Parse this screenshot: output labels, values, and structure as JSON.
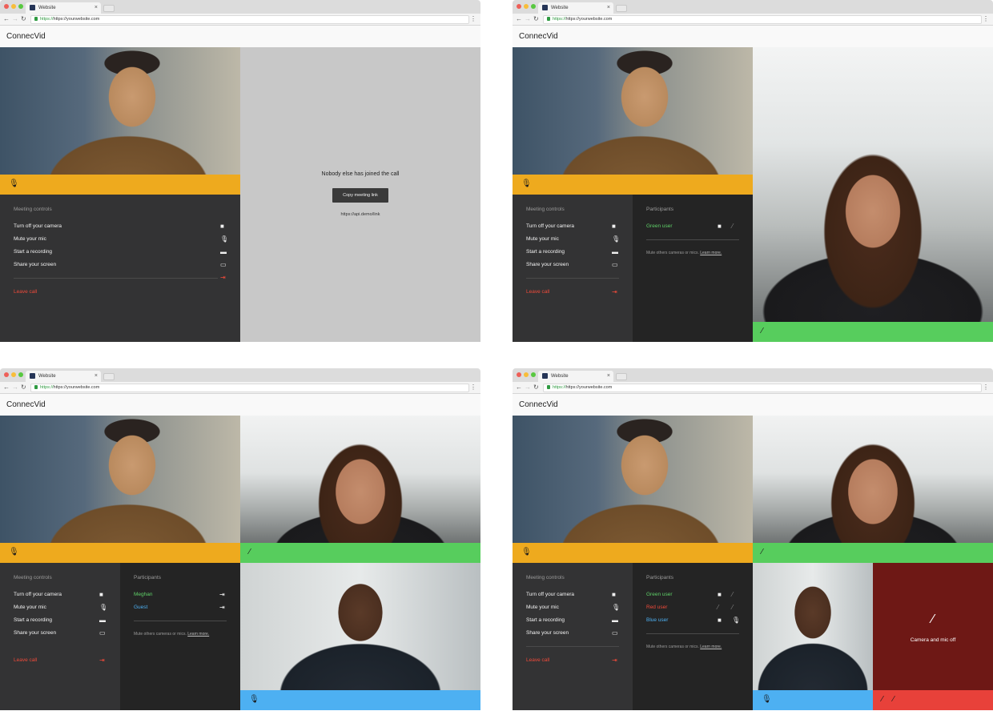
{
  "browser": {
    "tab_title": "Website",
    "tab_close": "×",
    "url_proto": "https://",
    "url_rest": "https://yourwebsite.com",
    "back": "←",
    "forward": "→",
    "reload": "↻",
    "menu": "⋮"
  },
  "app": {
    "brand": "ConnecVid"
  },
  "icons": {
    "mic": "🎙",
    "mic_off": "⁄",
    "camera": "■",
    "record": "▬",
    "screen": "▭",
    "leave": "⇥",
    "cam_off": "⁄"
  },
  "controls": {
    "title": "Meeting controls",
    "camera": "Turn off your camera",
    "mic": "Mute your mic",
    "record": "Start a recording",
    "screen": "Share your screen",
    "leave": "Leave call"
  },
  "participants_title": "Participants",
  "note": {
    "text": "Mute others cameras or mics.",
    "link": "Learn more."
  },
  "screen1": {
    "nobody": "Nobody else has joined the call",
    "copy_button": "Copy meeting link",
    "link": "https://api.demo/link"
  },
  "screen2": {
    "participants": [
      {
        "name": "Green user",
        "color": "#5fd068"
      }
    ]
  },
  "screen3": {
    "participants": [
      {
        "name": "Meghan",
        "color": "#5fd068"
      },
      {
        "name": "Guest",
        "color": "#4db0f2"
      }
    ]
  },
  "screen4": {
    "participants": [
      {
        "name": "Green user",
        "color": "#5fd068"
      },
      {
        "name": "Red user",
        "color": "#ef4a3a"
      },
      {
        "name": "Blue user",
        "color": "#4db0f2"
      }
    ],
    "camera_off": "Camera and mic off"
  },
  "colors": {
    "orange": "#eeaa1e",
    "green": "#57cd5d",
    "blue": "#4db0f2",
    "red": "#e8413a",
    "panel": "#333334",
    "panel_dark": "#242424"
  }
}
